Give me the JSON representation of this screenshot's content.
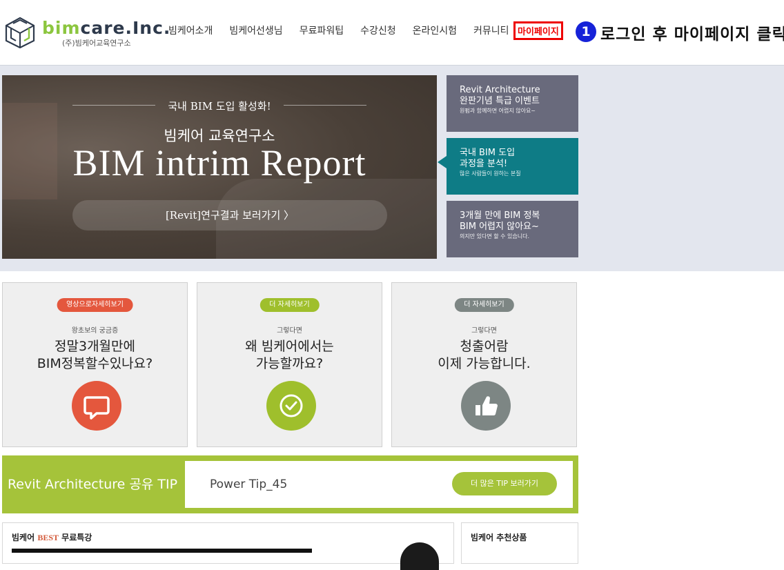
{
  "logo": {
    "brand_bim": "bim",
    "brand_rest": "care.Inc.",
    "subtitle": "(주)빔케어교육연구소"
  },
  "nav": {
    "items": [
      "빔케어소개",
      "빔케어선생님",
      "무료파워팁",
      "수강신청",
      "온라인시험",
      "커뮤니티"
    ],
    "mypage": "마이페이지"
  },
  "annotation": {
    "number": "1",
    "text": "로그인 후 마이페이지 클릭"
  },
  "hero": {
    "kicker": "국내 BIM 도입 활성화!",
    "subtitle": "빔케어 교육연구소",
    "title": "BIM intrim Report",
    "button": "[Revit]연구결과 보러가기  〉"
  },
  "side_boxes": [
    {
      "line1": "Revit Architecture",
      "line2": "완판기념 특급 이벤트",
      "line3": "원펌과 함께하면 어렵지 않아요~",
      "active": false
    },
    {
      "line1": "국내 BIM 도입",
      "line2": "과정을 분석!",
      "line3": "많은 사람들이 원하는 본질",
      "active": true
    },
    {
      "line1": "3개월 만에 BIM 정복",
      "line2": "BIM 어렵지 않아요~",
      "line3": "의지만 있다면 할 수 있습니다.",
      "active": false
    }
  ],
  "cards": [
    {
      "badge": "영상으로자세히보기",
      "kicker": "왕초보의 궁금증",
      "line1": "정말3개월만에",
      "line2": "BIM정복할수있나요?",
      "icon": "chat-icon",
      "badge_color": "#e4573d",
      "icon_color": "#e4573d"
    },
    {
      "badge": "더 자세히보기",
      "kicker": "그렇다면",
      "line1": "왜 빔케어에서는",
      "line2": "가능할까요?",
      "icon": "check-icon",
      "badge_color": "#9fbf2c",
      "icon_color": "#9fbf2c"
    },
    {
      "badge": "더 자세히보기",
      "kicker": "그렇다면",
      "line1": "청출어람",
      "line2": "이제 가능합니다.",
      "icon": "thumbs-up-icon",
      "badge_color": "#7d8684",
      "icon_color": "#7d8684"
    }
  ],
  "tip": {
    "label": "Revit Architecture 공유 TIP",
    "title": "Power Tip_45",
    "button": "더 많은 TIP 보러가기"
  },
  "panels": {
    "best_prefix": "빔케어 ",
    "best_word": "BEST",
    "best_suffix": " 무료특강",
    "recommend": "빔케어 추천상품"
  }
}
